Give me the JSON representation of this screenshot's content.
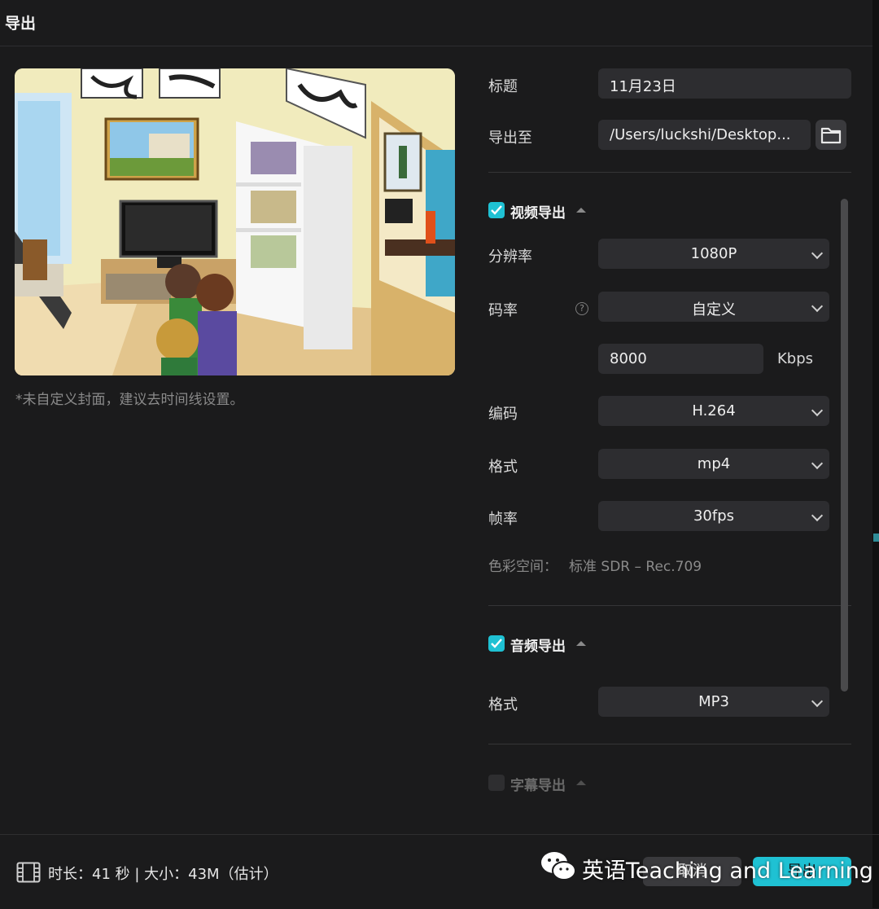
{
  "window": {
    "title": "导出"
  },
  "preview": {
    "cover_note": "*未自定义封面，建议去时间线设置。"
  },
  "form": {
    "title_label": "标题",
    "title_value": "11月23日",
    "export_to_label": "导出至",
    "export_to_value": "/Users/luckshi/Desktop...",
    "folder_icon": "folder-icon"
  },
  "video": {
    "section_title": "视频导出",
    "checked": true,
    "resolution_label": "分辨率",
    "resolution_value": "1080P",
    "bitrate_label": "码率",
    "bitrate_help_glyph": "?",
    "bitrate_value": "自定义",
    "bitrate_custom_value": "8000",
    "bitrate_unit": "Kbps",
    "codec_label": "编码",
    "codec_value": "H.264",
    "format_label": "格式",
    "format_value": "mp4",
    "framerate_label": "帧率",
    "framerate_value": "30fps",
    "colorspace_label": "色彩空间：",
    "colorspace_value": "标准 SDR – Rec.709"
  },
  "audio": {
    "section_title": "音频导出",
    "checked": true,
    "format_label": "格式",
    "format_value": "MP3"
  },
  "subtitle": {
    "section_title": "字幕导出",
    "checked": false
  },
  "footer": {
    "info": "时长：41 秒 | 大小：43M（估计）",
    "cancel_label": "取消",
    "export_label": "导出"
  },
  "watermark": {
    "text": "英语Teaching and Learning"
  },
  "colors": {
    "accent": "#1fc1d3",
    "background": "#1b1b1c",
    "field": "#2d2d30"
  }
}
